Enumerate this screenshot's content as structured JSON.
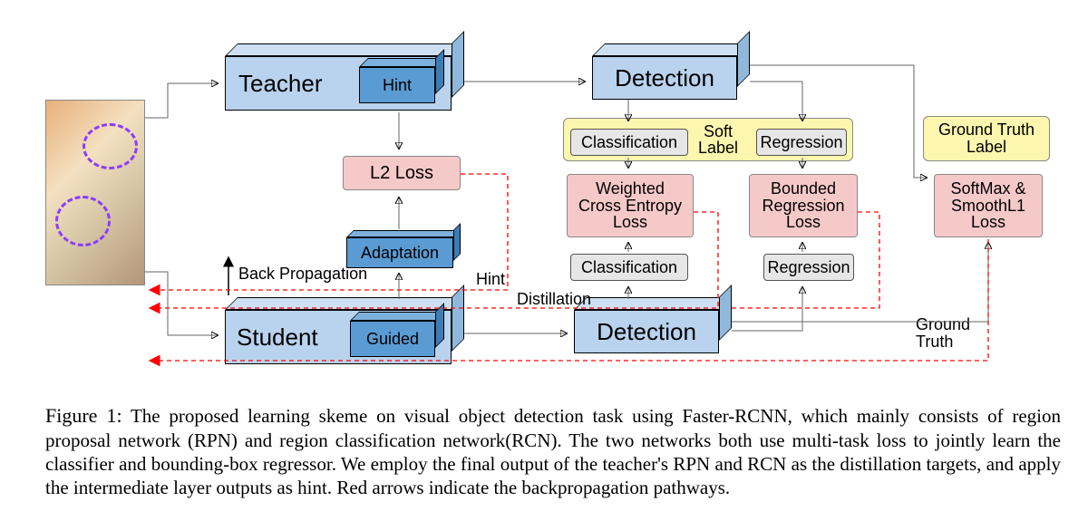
{
  "domain": "Diagram",
  "blocks": {
    "teacher": "Teacher",
    "hint": "Hint",
    "student": "Student",
    "guided": "Guided",
    "adaptation": "Adaptation",
    "detection_top": "Detection",
    "detection_bottom": "Detection"
  },
  "pinkBoxes": {
    "l2": "L2 Loss",
    "wce": "Weighted\nCross Entropy\nLoss",
    "brl": "Bounded\nRegression\nLoss",
    "softmax": "SoftMax &\nSmoothL1\nLoss"
  },
  "yellowBoxes": {
    "softlabel": "Soft\nLabel",
    "gt": "Ground Truth\nLabel"
  },
  "greyBoxes": {
    "cls_top": "Classification",
    "reg_top": "Regression",
    "cls_bottom": "Classification",
    "reg_bottom": "Regression"
  },
  "labels": {
    "backprop": "Back Propagation",
    "hint": "Hint",
    "distillation": "Distillation",
    "groundTruth": "Ground\nTruth"
  },
  "caption": {
    "prefix": "Figure 1:",
    "body": " The proposed learning skeme on visual object detection task using Faster-RCNN, which mainly consists of region proposal network (RPN) and region classification network(RCN). The two networks both use multi-task loss to jointly learn the classifier and bounding-box regressor. We employ the final output of the teacher's RPN and RCN as the distillation targets, and apply the intermediate layer outputs as hint. Red arrows indicate the backpropagation pathways."
  }
}
